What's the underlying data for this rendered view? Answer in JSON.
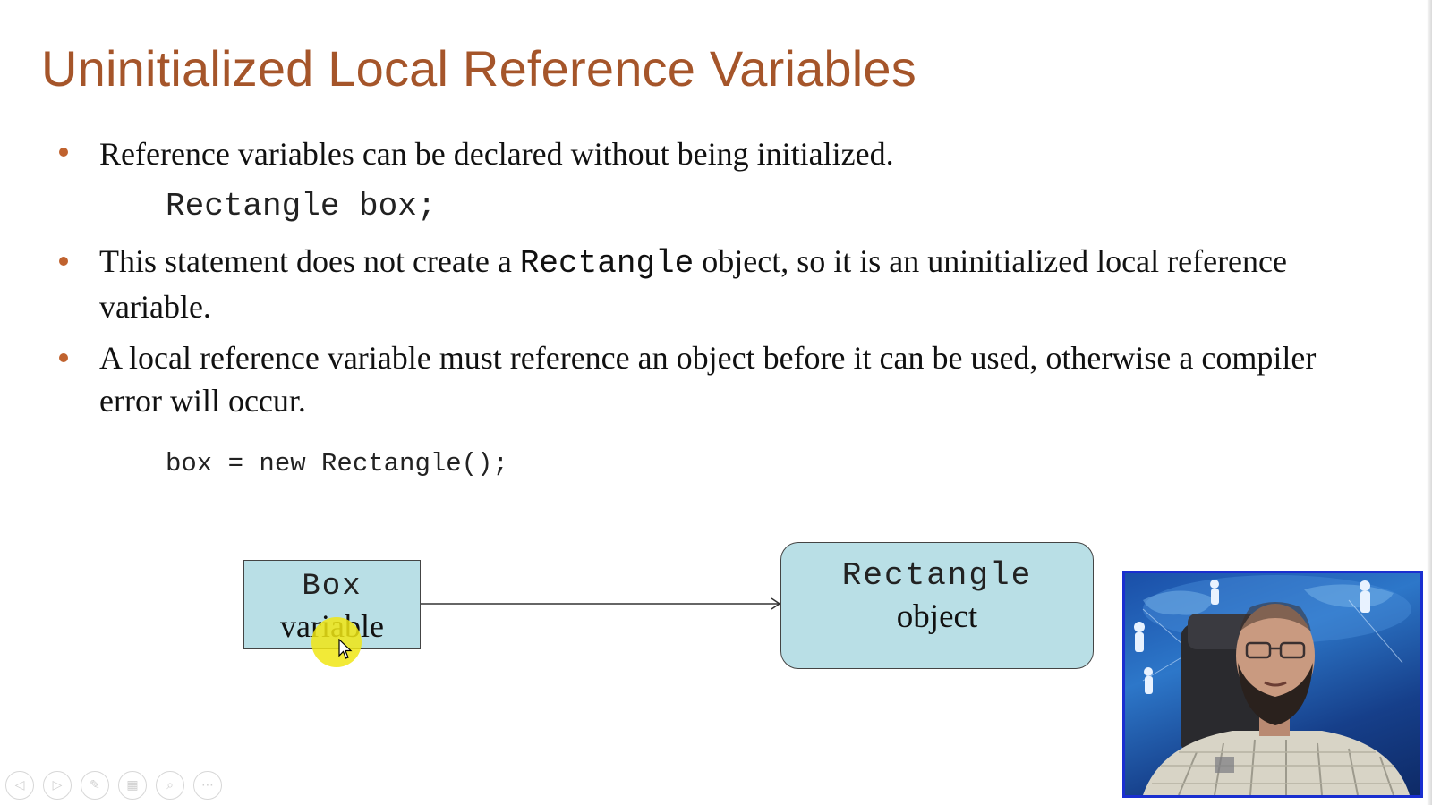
{
  "slide": {
    "title": "Uninitialized Local Reference Variables",
    "bullets": [
      {
        "text": "Reference variables can be declared without being initialized."
      },
      {
        "text_before": "This statement does not create a ",
        "code": "Rectangle",
        "text_after": " object, so it is an uninitialized local reference variable."
      },
      {
        "text": "A local reference variable must reference an object before it can be used, otherwise a compiler error will occur."
      }
    ],
    "code_declaration": "Rectangle box;",
    "code_assignment": "box = new Rectangle();",
    "diagram": {
      "variable_box_line1": "Box",
      "variable_box_line2": "variable",
      "object_box_line1": "Rectangle",
      "object_box_line2": "object"
    }
  },
  "presentation_controls": [
    {
      "icon": "previous-icon",
      "glyph": "◁"
    },
    {
      "icon": "next-icon",
      "glyph": "▷"
    },
    {
      "icon": "pen-icon",
      "glyph": "✎"
    },
    {
      "icon": "slides-icon",
      "glyph": "▦"
    },
    {
      "icon": "zoom-icon",
      "glyph": "⌕"
    },
    {
      "icon": "more-icon",
      "glyph": "⋯"
    }
  ],
  "colors": {
    "title": "#a5552a",
    "bullet": "#c0622e",
    "diagram_fill": "#b9dfe6",
    "webcam_border": "#1a2fd0"
  }
}
